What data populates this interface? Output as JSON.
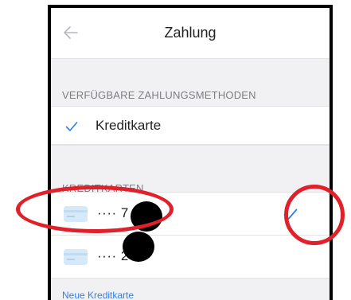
{
  "nav": {
    "title": "Zahlung",
    "back_icon": "arrow-left-icon"
  },
  "methods": {
    "header": "VERFÜGBARE ZAHLUNGSMETHODEN",
    "items": [
      {
        "label": "Kreditkarte",
        "selected": true
      }
    ]
  },
  "cards": {
    "header": "KREDITKARTEN",
    "items": [
      {
        "masked_number": "···· 7",
        "selected": true
      },
      {
        "masked_number": "···· 2",
        "selected": false
      }
    ],
    "add_label": "Neue Kreditkarte"
  },
  "colors": {
    "accent": "#2f80ed",
    "annotation": "#e0202a",
    "section_bg": "#f1f1f3"
  }
}
